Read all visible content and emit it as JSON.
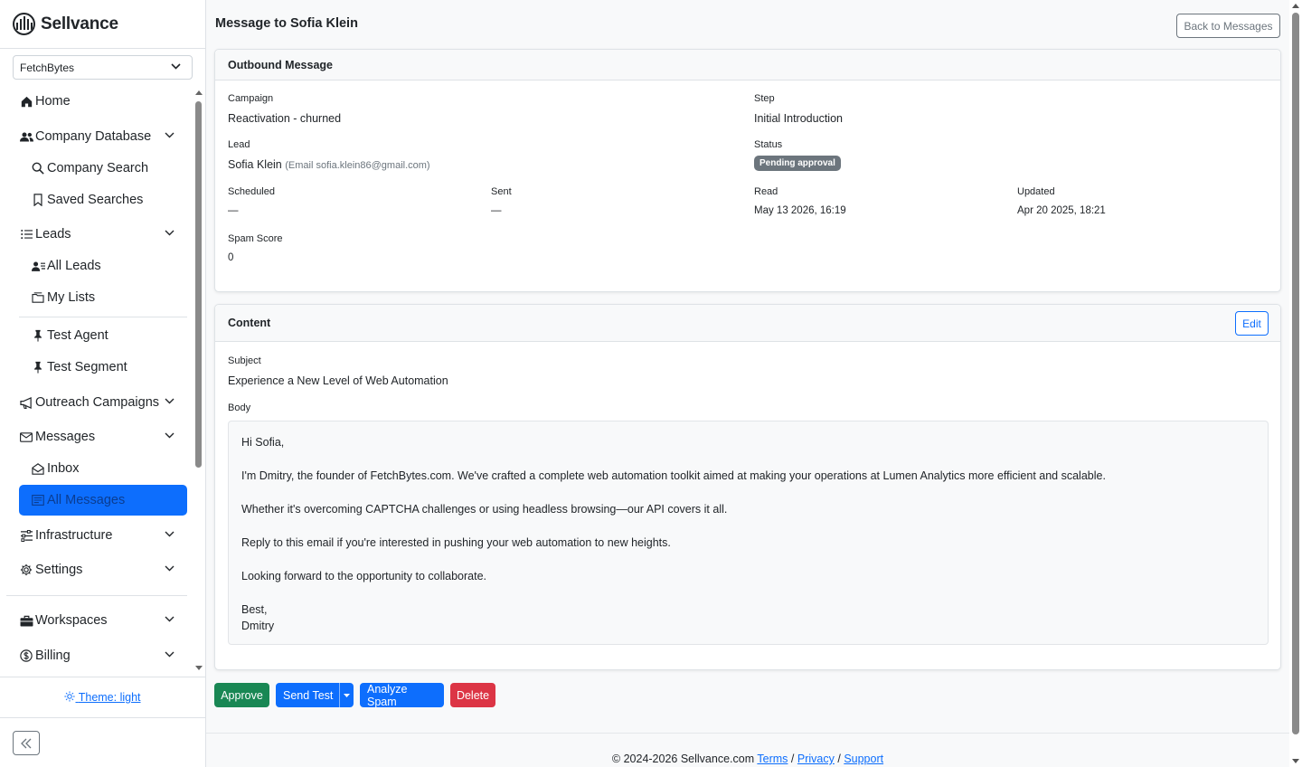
{
  "brand": {
    "name": "Sellvance"
  },
  "workspace_select": {
    "value": "FetchBytes"
  },
  "sidebar": {
    "items": [
      {
        "label": "Home",
        "icon": "house-icon"
      },
      {
        "label": "Company Database",
        "icon": "people-icon"
      },
      {
        "label": "Company Search",
        "icon": "search-icon"
      },
      {
        "label": "Saved Searches",
        "icon": "bookmark-icon"
      },
      {
        "label": "Leads",
        "icon": "list-icon"
      },
      {
        "label": "All Leads",
        "icon": "person-lines-icon"
      },
      {
        "label": "My Lists",
        "icon": "folder-icon"
      },
      {
        "label": "Test Agent",
        "icon": "pin-icon"
      },
      {
        "label": "Test Segment",
        "icon": "pin-icon"
      },
      {
        "label": "Outreach Campaigns",
        "icon": "megaphone-icon"
      },
      {
        "label": "Messages",
        "icon": "envelope-icon"
      },
      {
        "label": "Inbox",
        "icon": "envelope-open-icon"
      },
      {
        "label": "All Messages",
        "icon": "messages-icon"
      },
      {
        "label": "Infrastructure",
        "icon": "sliders-icon"
      },
      {
        "label": "Settings",
        "icon": "gear-icon"
      },
      {
        "label": "Workspaces",
        "icon": "briefcase-icon"
      },
      {
        "label": "Billing",
        "icon": "currency-icon"
      }
    ],
    "theme_label": "Theme: light"
  },
  "header": {
    "title": "Message to Sofia Klein",
    "back_label": "Back to Messages"
  },
  "outbound": {
    "title": "Outbound Message",
    "campaign_label": "Campaign",
    "campaign_value": "Reactivation - churned",
    "step_label": "Step",
    "step_value": "Initial Introduction",
    "lead_label": "Lead",
    "lead_name": "Sofia Klein",
    "lead_email": "(Email sofia.klein86@gmail.com)",
    "status_label": "Status",
    "status_value": "Pending approval",
    "scheduled_label": "Scheduled",
    "scheduled_value": "—",
    "sent_label": "Sent",
    "sent_value": "—",
    "read_label": "Read",
    "read_value": "May 13 2026, 16:19",
    "updated_label": "Updated",
    "updated_value": "Apr 20 2025, 18:21",
    "spam_label": "Spam Score",
    "spam_value": "0"
  },
  "content": {
    "title": "Content",
    "edit_label": "Edit",
    "subject_label": "Subject",
    "subject_value": "Experience a New Level of Web Automation",
    "body_label": "Body",
    "body": {
      "greeting": "Hi Sofia,",
      "p1": "I'm Dmitry, the founder of FetchBytes.com. We've crafted a complete web automation toolkit aimed at making your operations at Lumen Analytics more efficient and scalable.",
      "p2": "Whether it's overcoming CAPTCHA challenges or using headless browsing—our API covers it all.",
      "p3": "Reply to this email if you're interested in pushing your web automation to new heights.",
      "p4": "Looking forward to the opportunity to collaborate.",
      "signoff": "Best,",
      "signature": "Dmitry"
    }
  },
  "actions": {
    "approve": "Approve",
    "send_test": "Send Test",
    "analyze_spam": "Analyze Spam",
    "delete": "Delete"
  },
  "footer": {
    "copyright": "© 2024-2026 Sellvance.com",
    "terms": "Terms",
    "sep": "/",
    "privacy": "Privacy",
    "support": "Support"
  },
  "colors": {
    "primary": "#0d6efd",
    "success": "#198754",
    "danger": "#dc3545",
    "secondary": "#6c757d"
  }
}
